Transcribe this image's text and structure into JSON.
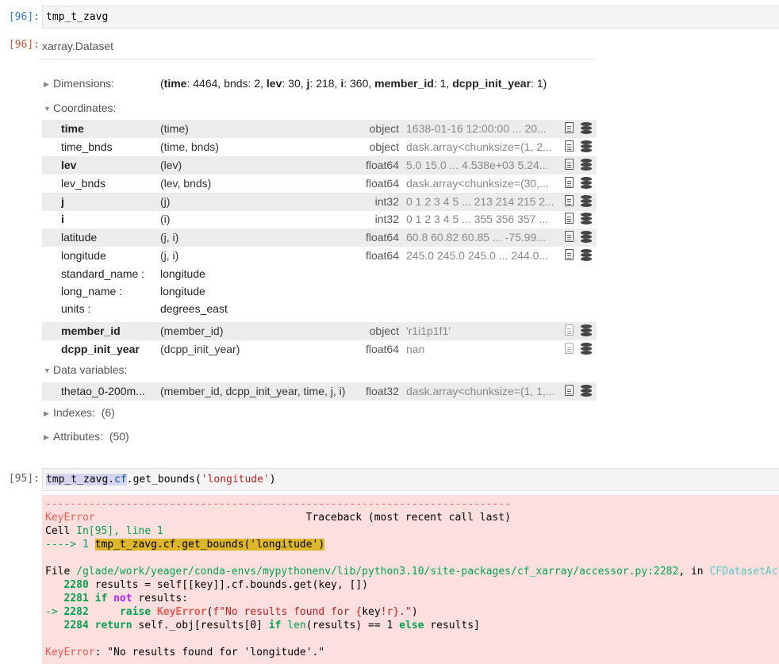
{
  "cell96": {
    "in_prompt": "[96]:",
    "code": "tmp_t_zavg",
    "out_prompt": "[96]:"
  },
  "dataset": {
    "type_label": "xarray.Dataset",
    "dimensions": {
      "label": "Dimensions:",
      "open_paren": "(",
      "items": [
        {
          "name": "time",
          "sep": ": ",
          "size": "4464",
          "bold": true
        },
        {
          "name": "bnds",
          "sep": ": ",
          "size": "2",
          "bold": false
        },
        {
          "name": "lev",
          "sep": ": ",
          "size": "30",
          "bold": true
        },
        {
          "name": "j",
          "sep": ": ",
          "size": "218",
          "bold": true
        },
        {
          "name": "i",
          "sep": ": ",
          "size": "360",
          "bold": true
        },
        {
          "name": "member_id",
          "sep": ": ",
          "size": "1",
          "bold": true
        },
        {
          "name": "dcpp_init_year",
          "sep": ": ",
          "size": "1",
          "bold": true
        }
      ],
      "close_paren": ")"
    },
    "coordinates_label": "Coordinates:",
    "coordinates": [
      {
        "name": "time",
        "dims": "(time)",
        "dtype": "object",
        "preview": "1638-01-16 12:00:00 ... 20...",
        "bold": true
      },
      {
        "name": "time_bnds",
        "dims": "(time, bnds)",
        "dtype": "object",
        "preview": "dask.array<chunksize=(1, 2...",
        "bold": false
      },
      {
        "name": "lev",
        "dims": "(lev)",
        "dtype": "float64",
        "preview": "5.0 15.0 ... 4.538e+03 5.24...",
        "bold": true
      },
      {
        "name": "lev_bnds",
        "dims": "(lev, bnds)",
        "dtype": "float64",
        "preview": "dask.array<chunksize=(30,...",
        "bold": false
      },
      {
        "name": "j",
        "dims": "(j)",
        "dtype": "int32",
        "preview": "0 1 2 3 4 5 ... 213 214 215 2...",
        "bold": true
      },
      {
        "name": "i",
        "dims": "(i)",
        "dtype": "int32",
        "preview": "0 1 2 3 4 5 ... 355 356 357 ...",
        "bold": true
      },
      {
        "name": "latitude",
        "dims": "(j, i)",
        "dtype": "float64",
        "preview": "60.8 60.82 60.85 ... -75.99...",
        "bold": false
      },
      {
        "name": "longitude",
        "dims": "(j, i)",
        "dtype": "float64",
        "preview": "245.0 245.0 245.0 ... 244.0...",
        "bold": false
      }
    ],
    "longitude_attrs": [
      {
        "key": "standard_name :",
        "value": "longitude"
      },
      {
        "key": "long_name :",
        "value": "longitude"
      },
      {
        "key": "units :",
        "value": "degrees_east"
      }
    ],
    "coordinates_more": [
      {
        "name": "member_id",
        "dims": "(member_id)",
        "dtype": "object",
        "preview": "'r1i1p1f1'",
        "bold": true
      },
      {
        "name": "dcpp_init_year",
        "dims": "(dcpp_init_year)",
        "dtype": "float64",
        "preview": "nan",
        "bold": true
      }
    ],
    "data_vars_label": "Data variables:",
    "data_vars": [
      {
        "name": "thetao_0-200m...",
        "dims": "(member_id, dcpp_init_year, time, j, i)",
        "dtype": "float32",
        "preview": "dask.array<chunksize=(1, 1,...",
        "bold": false
      }
    ],
    "indexes_label": "Indexes:",
    "indexes_count": "(6)",
    "attributes_label": "Attributes:",
    "attributes_count": "(50)"
  },
  "cell95": {
    "in_prompt": "[95]:",
    "code_obj": "tmp_t_zavg",
    "code_dot1": ".",
    "code_cf": "cf",
    "code_dot2": ".",
    "code_fn": "get_bounds(",
    "code_arg": "'longitude'",
    "code_close": ")"
  },
  "traceback": {
    "dashes": "---------------------------------------------------------------------------",
    "error_name": "KeyError",
    "traceback_header": "Traceback (most recent call last)",
    "cell_prefix": "Cell ",
    "cell_ref": "In[95], line 1",
    "arrow_line": "----> 1 ",
    "arrow_code": "tmp_t_zavg.cf.get_bounds('longitude')",
    "file_label": "File ",
    "file_path": "/glade/work/yeager/conda-envs/mypythonenv/lib/python3.10/site-packages/cf_xarray/accessor.py:2282",
    "file_in": ", in ",
    "file_func": "CFDatasetAccessor.get_bounds(self, key)",
    "lines": [
      {
        "num": "2280",
        "code": " results = self[[key]].cf.bounds.get(key, [])"
      },
      {
        "num": "2281",
        "code": "if not results:"
      },
      {
        "num": "2282",
        "code": "raise KeyError(f\"No results found for {key!r}.\")"
      },
      {
        "num": "2284",
        "code": "return self._obj[results[0] if len(results) == 1 else results]"
      }
    ],
    "final_error": "KeyError",
    "final_message": ": \"No results found for 'longitude'.\""
  }
}
